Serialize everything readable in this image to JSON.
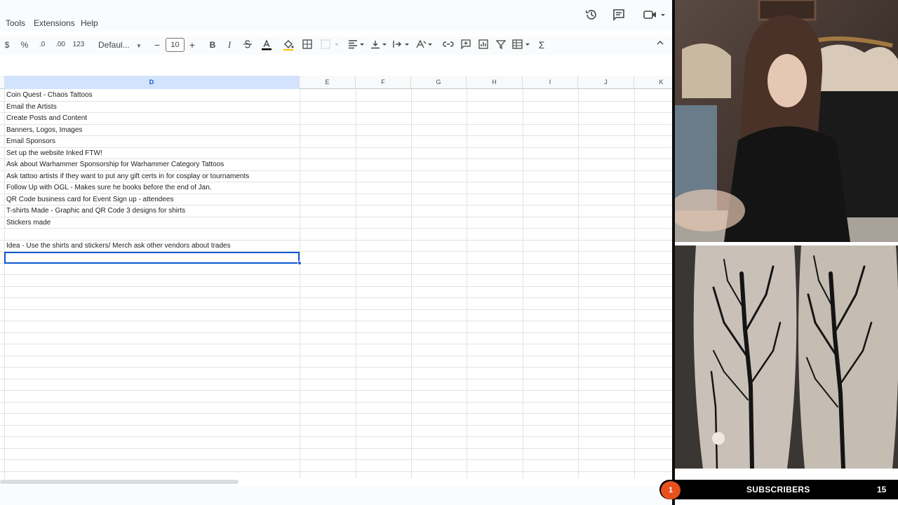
{
  "menu": {
    "tools": "Tools",
    "extensions": "Extensions",
    "help": "Help"
  },
  "toolbar": {
    "currency": "$",
    "percent": "%",
    "decrease_decimal": ".0",
    "increase_decimal": ".00",
    "number_format": "123",
    "font_name": "Defaul...",
    "font_size": "10",
    "bold": "B",
    "italic": "I"
  },
  "columns": [
    "D",
    "E",
    "F",
    "G",
    "H",
    "I",
    "J",
    "K"
  ],
  "rows": [
    "Coin Quest - Chaos Tattoos",
    "Email the Artists",
    "Create Posts and Content",
    "Banners, Logos, Images",
    "Email Sponsors",
    "Set up the website Inked FTW!",
    "Ask about Warhammer Sponsorship for Warhammer Category Tattoos",
    "Ask tattoo artists if they want to put any gift certs in for cosplay or tournaments",
    "Follow Up with OGL - Makes sure he books before the end of Jan.",
    "QR Code business card for Event Sign up - attendees",
    "T-shirts Made - Graphic and QR Code 3 designs for shirts",
    "Stickers made",
    "",
    "Idea - Use the shirts and stickers/ Merch ask other vendors about trades"
  ],
  "overlay": {
    "subscribers_label": "SUBSCRIBERS",
    "subscribers_count": "15",
    "badge_count": "1"
  },
  "colors": {
    "accent": "#0b57d0",
    "selected_header": "#d3e3fd",
    "badge": "#e8501e"
  }
}
